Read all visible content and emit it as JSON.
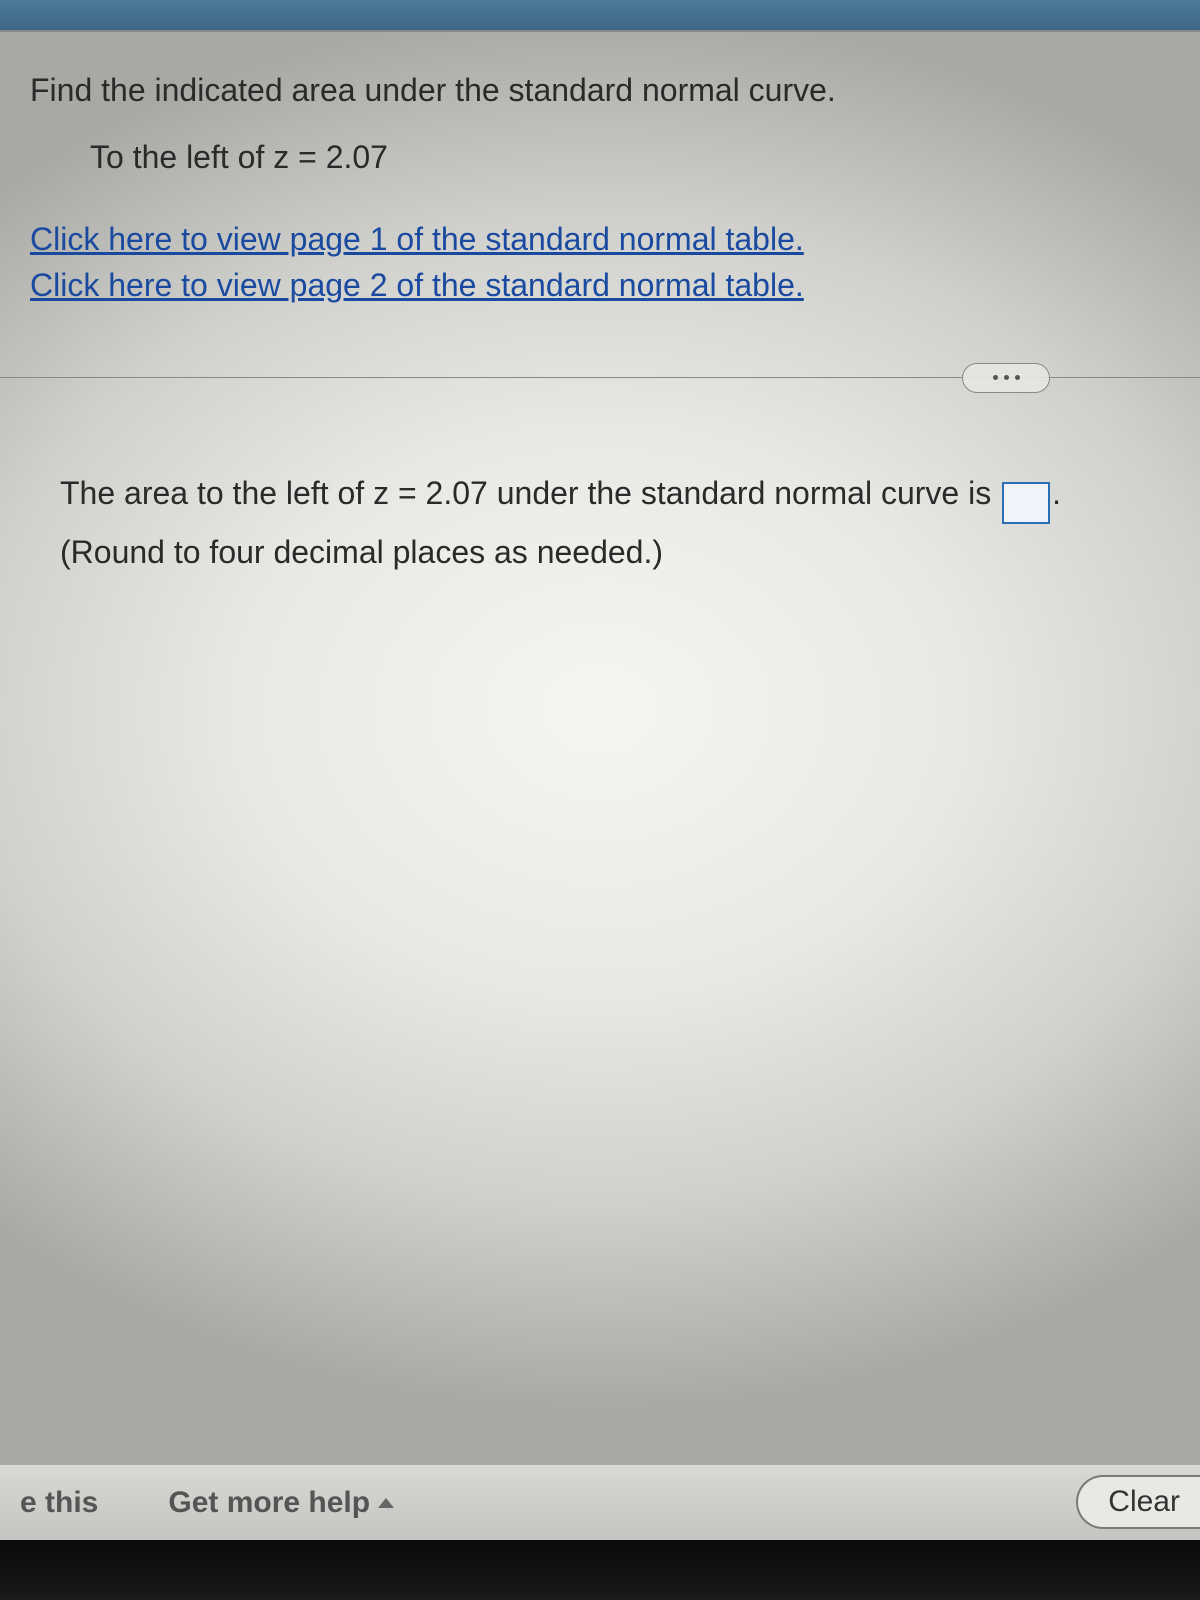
{
  "question": {
    "prompt": "Find the indicated area under the standard normal curve.",
    "sub_prompt": "To the left of z = 2.07",
    "links": {
      "page1": "Click here to view page 1 of the standard normal table.",
      "page2": "Click here to view page 2 of the standard normal table."
    },
    "answer_text_before": "The area to the left of z = 2.07 under the standard normal curve is ",
    "answer_text_after": ".",
    "hint": "(Round to four decimal places as needed.)",
    "answer_value": ""
  },
  "footer": {
    "e_this": "e this",
    "get_more_help": "Get more help",
    "clear": "Clear"
  }
}
